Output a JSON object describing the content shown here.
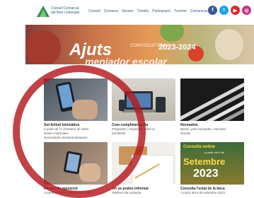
{
  "header": {
    "logo_line1": "Consell Comarcal",
    "logo_line2": "del Baix Llobregat",
    "nav": [
      "Consell",
      "Comarca",
      "Serveis",
      "Tràmits",
      "Participació",
      "Turisme",
      "Comunicació"
    ],
    "social": [
      {
        "icon": "facebook-icon",
        "glyph": "f",
        "color": "#3b5998"
      },
      {
        "icon": "twitter-icon",
        "glyph": "t",
        "color": "#1da1f2"
      },
      {
        "icon": "youtube-icon",
        "glyph": "▶",
        "color": "#d62b2b"
      },
      {
        "icon": "instagram-icon",
        "glyph": "◎",
        "color": "#c13584"
      }
    ]
  },
  "banner": {
    "convocatoria": "CONVOCATÒRIA",
    "title1": "Ajuts",
    "year": "2023-2024",
    "title2": "menjador escolar"
  },
  "cards": [
    {
      "title": "Sol·licitud telemàtica",
      "lines": [
        "a partir de l'1 d'octubre de 2023",
        "Noves matrícules",
        "Necessitats socioeconòmiques"
      ]
    },
    {
      "title": "Com complimentar-la",
      "lines": [
        "Preguntes i respostes sobre la",
        "tramitació"
      ]
    },
    {
      "title": "Normativa",
      "lines": [
        "Bases, preu menjador, calendari",
        "escolar"
      ]
    },
    {
      "title": "Recurs de reposició",
      "lines": [
        "A partir del 8 de setembre de 2023"
      ]
    },
    {
      "title": "On us podeu informar",
      "lines": [
        "Telèfons de contacte"
      ]
    },
    {
      "title": "Consulta l'estat de la beca",
      "lines": [
        "A partir del 6 de setembre 2023"
      ]
    }
  ],
  "card6_image": {
    "line1": "Consulta",
    "line2": "online",
    "line3": "a partir del 6 de",
    "month": "Setembre",
    "year": "2023"
  },
  "colors": {
    "brand": "#2d5a88",
    "overlay_ring": "#b3181f"
  }
}
